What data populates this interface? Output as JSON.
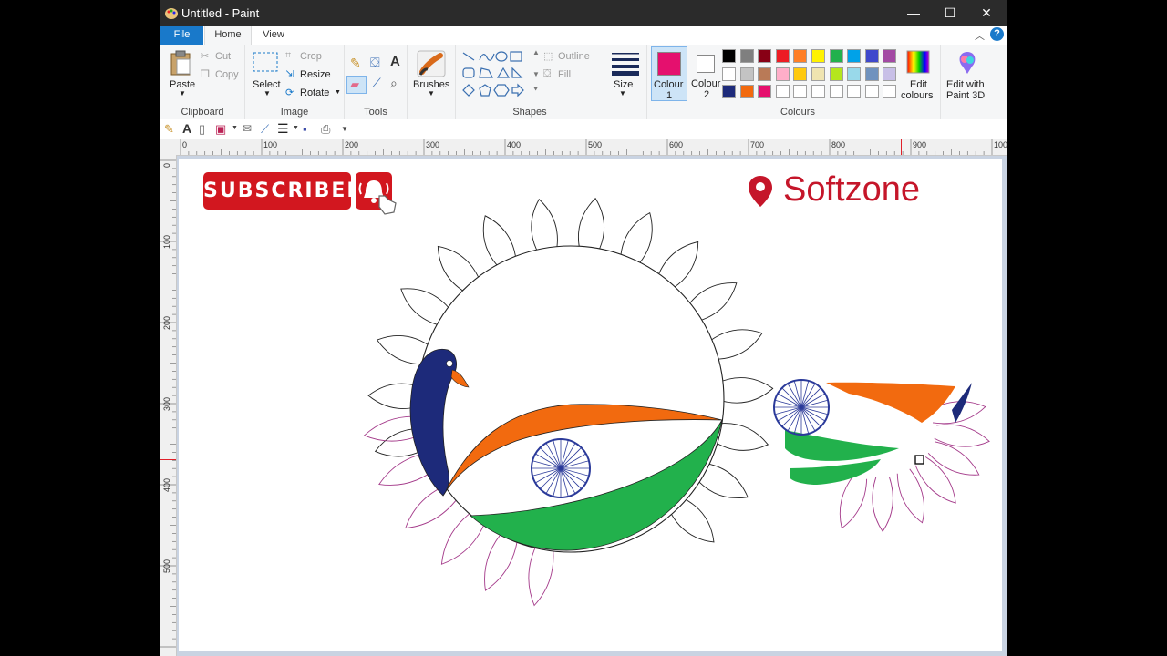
{
  "window": {
    "title": "Untitled - Paint",
    "minimize": "—",
    "maximize": "☐",
    "close": "✕"
  },
  "tabs": {
    "file": "File",
    "home": "Home",
    "view": "View"
  },
  "clipboard": {
    "paste": "Paste",
    "cut": "Cut",
    "copy": "Copy",
    "group": "Clipboard"
  },
  "image": {
    "select": "Select",
    "crop": "Crop",
    "resize": "Resize",
    "rotate": "Rotate",
    "group": "Image"
  },
  "tools": {
    "group": "Tools"
  },
  "brushes": {
    "label": "Brushes"
  },
  "shapes": {
    "outline": "Outline",
    "fill": "Fill",
    "group": "Shapes"
  },
  "size": {
    "label": "Size"
  },
  "colours": {
    "colour1_line1": "Colour",
    "colour1_line2": "1",
    "colour2_line1": "Colour",
    "colour2_line2": "2",
    "colour1_value": "#e5106e",
    "colour2_value": "#ffffff",
    "edit_line1": "Edit",
    "edit_line2": "colours",
    "paint3d_line1": "Edit with",
    "paint3d_line2": "Paint 3D",
    "group": "Colours",
    "palette": [
      [
        "#000000",
        "#7f7f7f",
        "#880015",
        "#ed1c24",
        "#ff7f27",
        "#fff200",
        "#22b14c",
        "#00a2e8",
        "#3f48cc",
        "#a349a4"
      ],
      [
        "#ffffff",
        "#c3c3c3",
        "#b97a57",
        "#ffaec9",
        "#ffc90e",
        "#efe4b0",
        "#b5e61d",
        "#99d9ea",
        "#7092be",
        "#c8bfe7"
      ],
      [
        "#1d2a7a",
        "#f26a0f",
        "#e5106e",
        "#ffffff",
        "#ffffff",
        "#ffffff",
        "#ffffff",
        "#ffffff",
        "#ffffff",
        "#ffffff"
      ]
    ]
  },
  "ruler": {
    "h": [
      "0",
      "100",
      "200",
      "300",
      "400",
      "500",
      "600",
      "700",
      "800",
      "900",
      "100"
    ],
    "v": [
      "0",
      "100",
      "200",
      "300",
      "400",
      "500"
    ]
  },
  "canvas": {
    "subscribe": "SUBSCRIBED",
    "brand": "Softzone",
    "brand_color": "#c5162a",
    "saffron": "#f26a0f",
    "green": "#22b14c",
    "navy": "#1d2a7a"
  }
}
